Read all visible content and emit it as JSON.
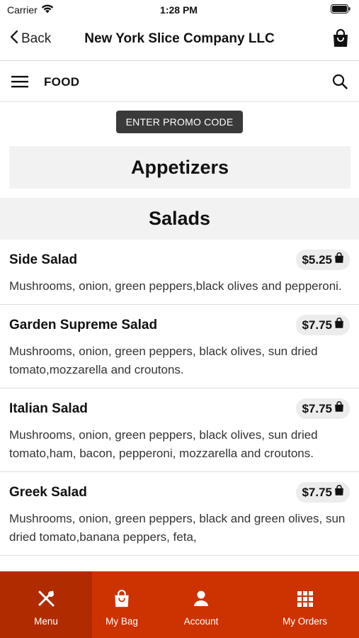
{
  "status": {
    "carrier": "Carrier",
    "time": "1:28 PM"
  },
  "nav": {
    "back_label": "Back",
    "title": "New York Slice Company LLC"
  },
  "subnav": {
    "title": "FOOD"
  },
  "promo": {
    "label": "ENTER PROMO CODE"
  },
  "categories": {
    "appetizers": "Appetizers",
    "salads": "Salads"
  },
  "items": [
    {
      "name": "Side Salad",
      "price": "$5.25",
      "desc": "Mushrooms, onion, green peppers,black olives and pepperoni."
    },
    {
      "name": "Garden Supreme Salad",
      "price": "$7.75",
      "desc": "Mushrooms, onion, green peppers, black olives, sun dried tomato,mozzarella and croutons."
    },
    {
      "name": "Italian Salad",
      "price": "$7.75",
      "desc": "Mushrooms, onion, green peppers, black olives, sun dried tomato,ham, bacon, pepperoni, mozzarella and croutons."
    },
    {
      "name": "Greek Salad",
      "price": "$7.75",
      "desc": "Mushrooms, onion, green peppers, black and green olives, sun dried tomato,banana peppers, feta,"
    }
  ],
  "tabs": {
    "menu": "Menu",
    "bag": "My Bag",
    "account": "Account",
    "orders": "My Orders"
  },
  "colors": {
    "accent": "#cc3300",
    "accent_active": "#b02c00",
    "promo_bg": "#3a3a3a",
    "section_bg": "#f2f2f2"
  }
}
